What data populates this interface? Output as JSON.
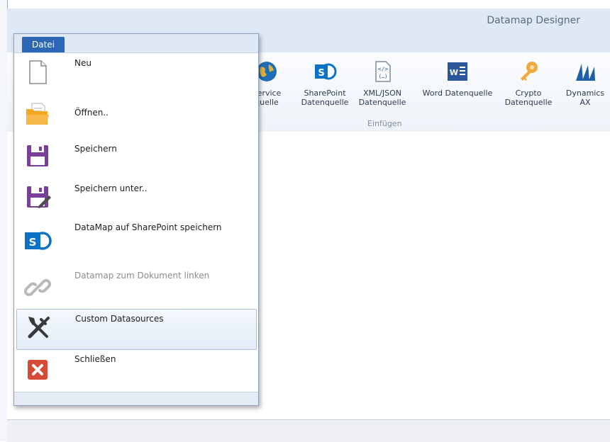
{
  "window": {
    "title": "Datamap Designer"
  },
  "ribbon": {
    "buttons": [
      {
        "label": "Service\nquelle",
        "icon": "globe-icon"
      },
      {
        "label": "SharePoint\nDatenquelle",
        "icon": "sharepoint-icon"
      },
      {
        "label": "XML/JSON\nDatenquelle",
        "icon": "xml-json-icon"
      },
      {
        "label": "Word Datenquelle",
        "icon": "word-icon"
      },
      {
        "label": "Crypto\nDatenquelle",
        "icon": "key-icon"
      },
      {
        "label": "Dynamics\nAX",
        "icon": "dynamics-icon"
      }
    ],
    "group_label": "Einfügen"
  },
  "file_menu": {
    "tab_label": "Datei",
    "items": [
      {
        "label": "Neu",
        "icon": "new-document-icon",
        "enabled": true
      },
      {
        "label": "Öffnen..",
        "icon": "open-folder-icon",
        "enabled": true
      },
      {
        "label": "Speichern",
        "icon": "save-icon",
        "enabled": true
      },
      {
        "label": "Speichern unter..",
        "icon": "save-as-icon",
        "enabled": true
      },
      {
        "label": "DataMap auf SharePoint speichern",
        "icon": "sharepoint-icon",
        "enabled": true
      },
      {
        "label": "Datamap zum Dokument linken",
        "icon": "link-icon",
        "enabled": false
      },
      {
        "label": "Custom Datasources",
        "icon": "tools-icon",
        "enabled": true,
        "highlighted": true
      },
      {
        "label": "Schließen",
        "icon": "close-icon",
        "enabled": true
      }
    ]
  },
  "colors": {
    "accent": "#2b67b4",
    "sharepoint": "#0b72c5",
    "word": "#2b579a",
    "save": "#7a3f98",
    "close": "#d64b38",
    "key": "#f2a93b"
  }
}
